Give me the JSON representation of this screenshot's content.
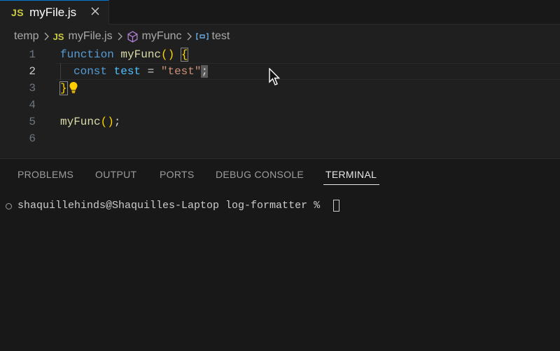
{
  "tab": {
    "badge": "JS",
    "label": "myFile.js"
  },
  "breadcrumb": {
    "folder": "temp",
    "file_badge": "JS",
    "file": "myFile.js",
    "function": "myFunc",
    "variable": "test"
  },
  "editor": {
    "line_numbers": [
      "1",
      "2",
      "3",
      "4",
      "5",
      "6"
    ],
    "active_line": 2
  },
  "code": {
    "l1_keyword": "function",
    "l1_name": "myFunc",
    "l1_parens": "()",
    "l1_brace": "{",
    "l2_keyword": "const",
    "l2_var": "test",
    "l2_op": "=",
    "l2_string": "\"test\"",
    "l2_semi": ";",
    "l3_brace": "}",
    "l5_call": "myFunc",
    "l5_parens": "()",
    "l5_semi": ";"
  },
  "panel": {
    "tabs": [
      "PROBLEMS",
      "OUTPUT",
      "PORTS",
      "DEBUG CONSOLE",
      "TERMINAL"
    ],
    "active_tab": "TERMINAL"
  },
  "terminal": {
    "prompt": "shaquillehinds@Shaquilles-Laptop log-formatter %"
  },
  "icons": {
    "close": "close-icon",
    "chevron": "chevron-right-icon",
    "function": "cube-icon",
    "variable": "variable-icon",
    "lightbulb": "lightbulb-icon",
    "cursor": "mouse-pointer-icon"
  },
  "colors": {
    "keyword": "#569cd6",
    "function": "#dcdcaa",
    "string": "#ce9178",
    "variable": "#4fc1ff",
    "js_badge": "#cbcb41",
    "tab_accent": "#0078d4"
  }
}
